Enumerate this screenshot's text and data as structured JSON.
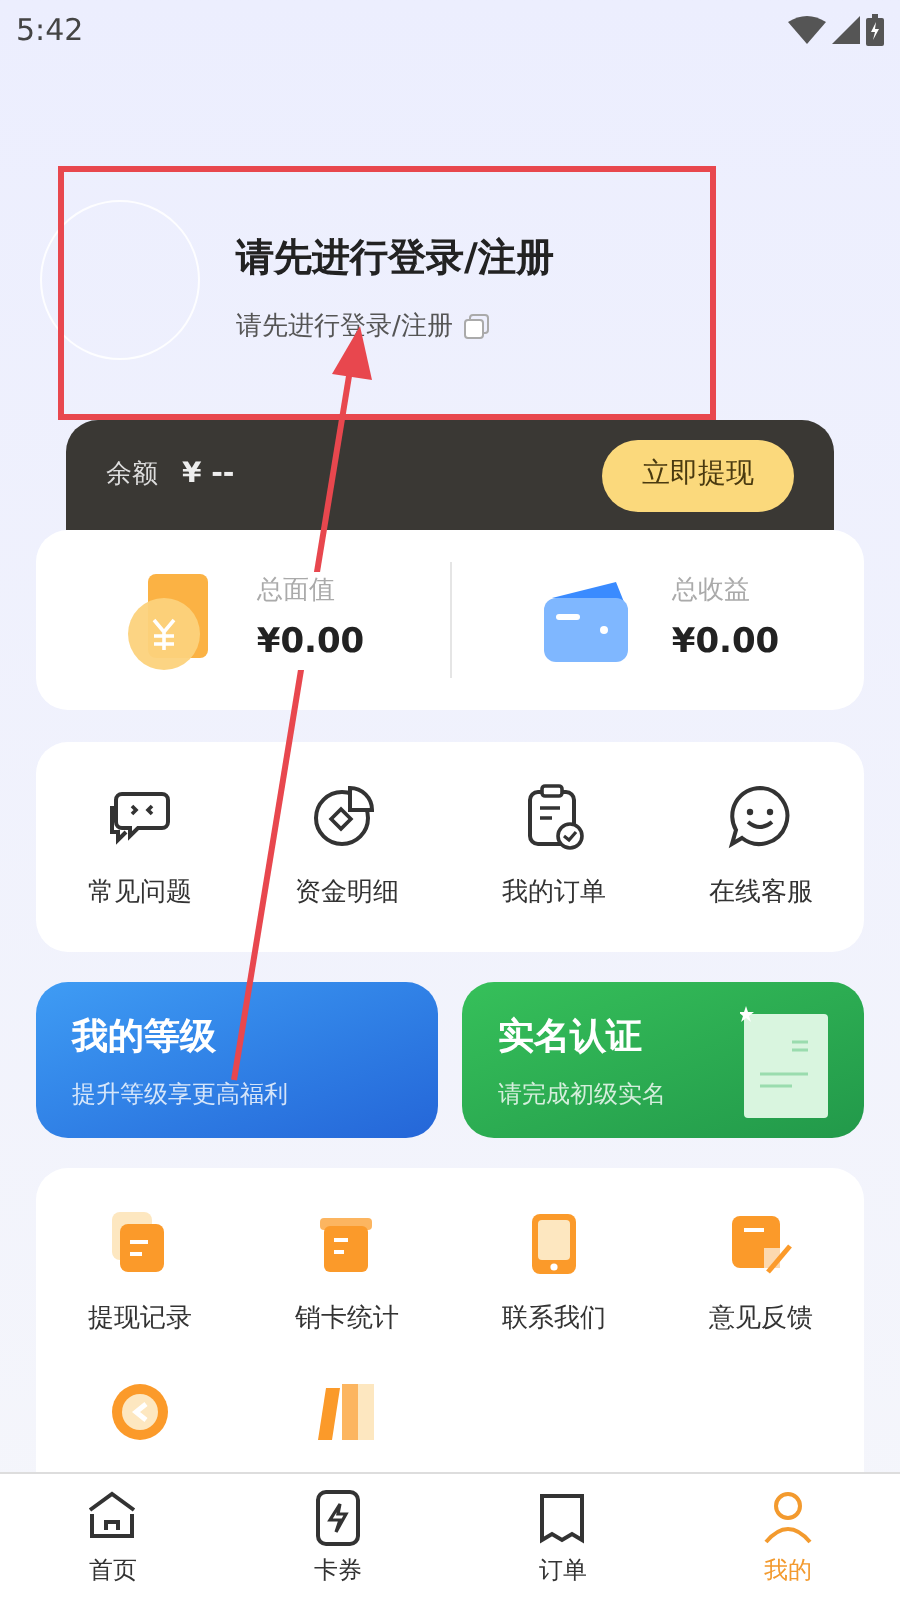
{
  "status_bar": {
    "time": "5:42"
  },
  "profile": {
    "title": "请先进行登录/注册",
    "subtitle": "请先进行登录/注册"
  },
  "balance": {
    "label": "余额",
    "value": "¥ --",
    "button": "立即提现"
  },
  "stats": [
    {
      "kind": "coin",
      "label": "总面值",
      "value": "¥0.00"
    },
    {
      "kind": "wallet",
      "label": "总收益",
      "value": "¥0.00"
    }
  ],
  "shortcuts": [
    {
      "kind": "chat",
      "label": "常见问题"
    },
    {
      "kind": "chart",
      "label": "资金明细"
    },
    {
      "kind": "clipboard",
      "label": "我的订单"
    },
    {
      "kind": "smile",
      "label": "在线客服"
    }
  ],
  "promo_cards": [
    {
      "kind": "level",
      "title": "我的等级",
      "subtitle": "提升等级享更高福利"
    },
    {
      "kind": "verify",
      "title": "实名认证",
      "subtitle": "请完成初级实名"
    }
  ],
  "tools": [
    {
      "kind": "record",
      "label": "提现记录"
    },
    {
      "kind": "box",
      "label": "销卡统计"
    },
    {
      "kind": "phone",
      "label": "联系我们"
    },
    {
      "kind": "note",
      "label": "意见反馈"
    },
    {
      "kind": "refresh"
    },
    {
      "kind": "books"
    }
  ],
  "tab_bar": [
    {
      "kind": "home",
      "label": "首页",
      "selected": false
    },
    {
      "kind": "card",
      "label": "卡券",
      "selected": false
    },
    {
      "kind": "order",
      "label": "订单",
      "selected": false
    },
    {
      "kind": "me",
      "label": "我的",
      "selected": true
    }
  ]
}
